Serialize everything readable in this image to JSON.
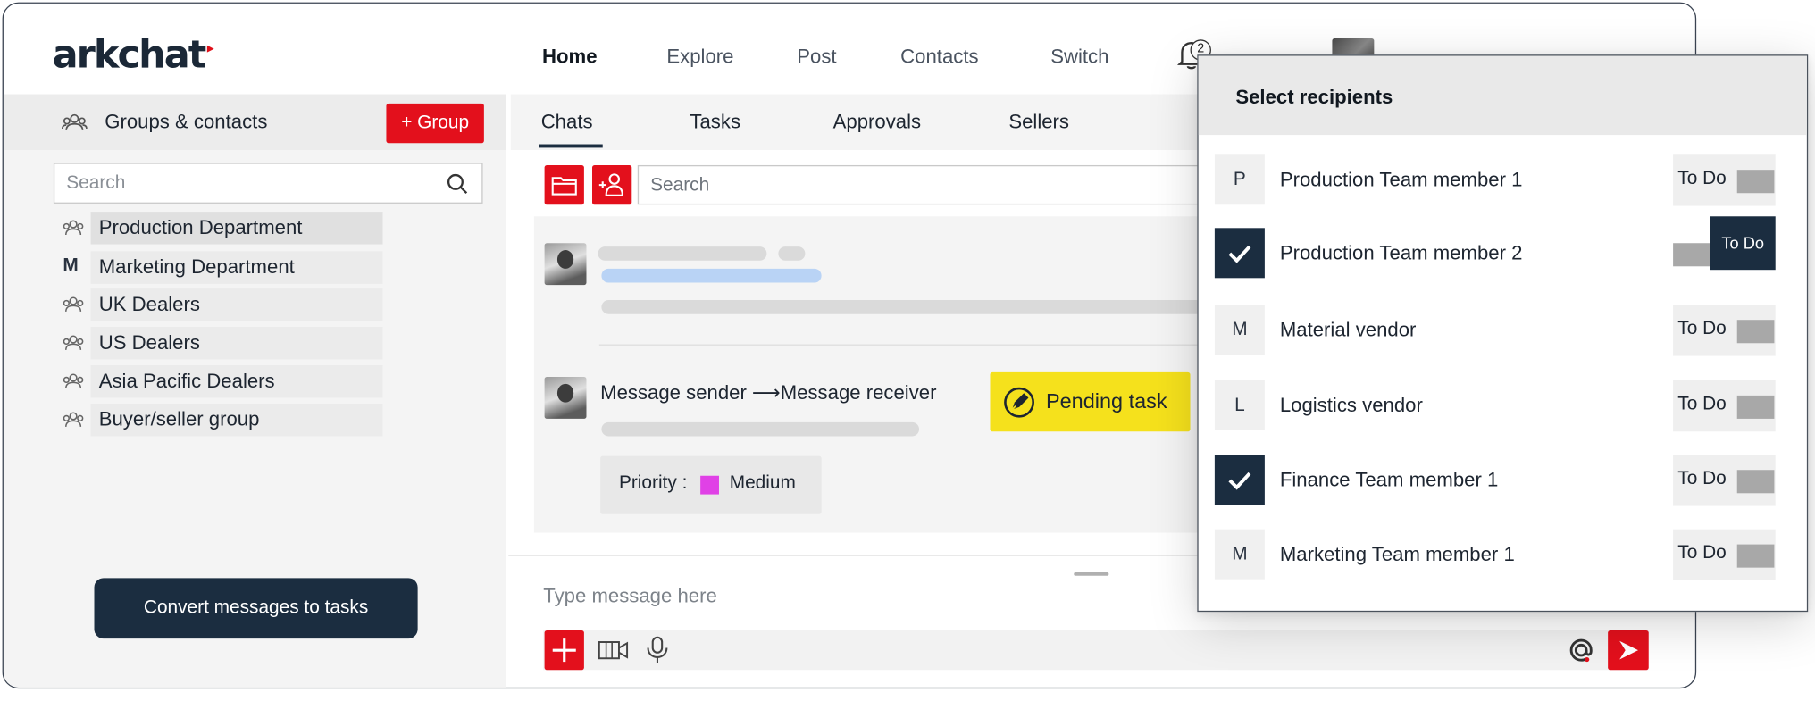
{
  "brand": {
    "name": "arkchat",
    "accent": "#e3101c",
    "navy": "#1b2d40"
  },
  "nav": {
    "items": [
      "Home",
      "Explore",
      "Post",
      "Contacts",
      "Switch"
    ],
    "notification_count": "2"
  },
  "sidebar": {
    "title": "Groups & contacts",
    "add_group_label": "+ Group",
    "search_placeholder": "Search",
    "items": [
      {
        "label": "Production Department",
        "icon": "people-icon"
      },
      {
        "label": "Marketing Department",
        "letter": "M"
      },
      {
        "label": "UK Dealers",
        "icon": "people-icon"
      },
      {
        "label": "US Dealers",
        "icon": "people-icon"
      },
      {
        "label": "Asia Pacific Dealers",
        "icon": "people-icon"
      },
      {
        "label": "Buyer/seller group",
        "icon": "people-icon"
      }
    ],
    "convert_button_label": "Convert messages to tasks"
  },
  "tabs": [
    "Chats",
    "Tasks",
    "Approvals",
    "Sellers"
  ],
  "chat": {
    "search_placeholder": "Search",
    "message": {
      "header": "Message sender ⟶Message receiver",
      "status_badge": "Pending task",
      "priority_label": "Priority :",
      "priority_value": "Medium",
      "priority_color": "#e041e6"
    },
    "composer_placeholder": "Type message here"
  },
  "recipients": {
    "title": "Select recipients",
    "rows": [
      {
        "mark": "P",
        "name": "Production Team member 1",
        "checked": false,
        "todo": "To Do",
        "todo_on": false
      },
      {
        "mark": "",
        "name": "Production Team member 2",
        "checked": true,
        "todo": "To Do",
        "todo_on": true
      },
      {
        "mark": "M",
        "name": "Material vendor",
        "checked": false,
        "todo": "To Do",
        "todo_on": false
      },
      {
        "mark": "L",
        "name": "Logistics vendor",
        "checked": false,
        "todo": "To Do",
        "todo_on": false
      },
      {
        "mark": "",
        "name": "Finance Team member 1",
        "checked": true,
        "todo": "To Do",
        "todo_on": false
      },
      {
        "mark": "M",
        "name": "Marketing Team member 1",
        "checked": false,
        "todo": "To Do",
        "todo_on": false
      }
    ]
  }
}
